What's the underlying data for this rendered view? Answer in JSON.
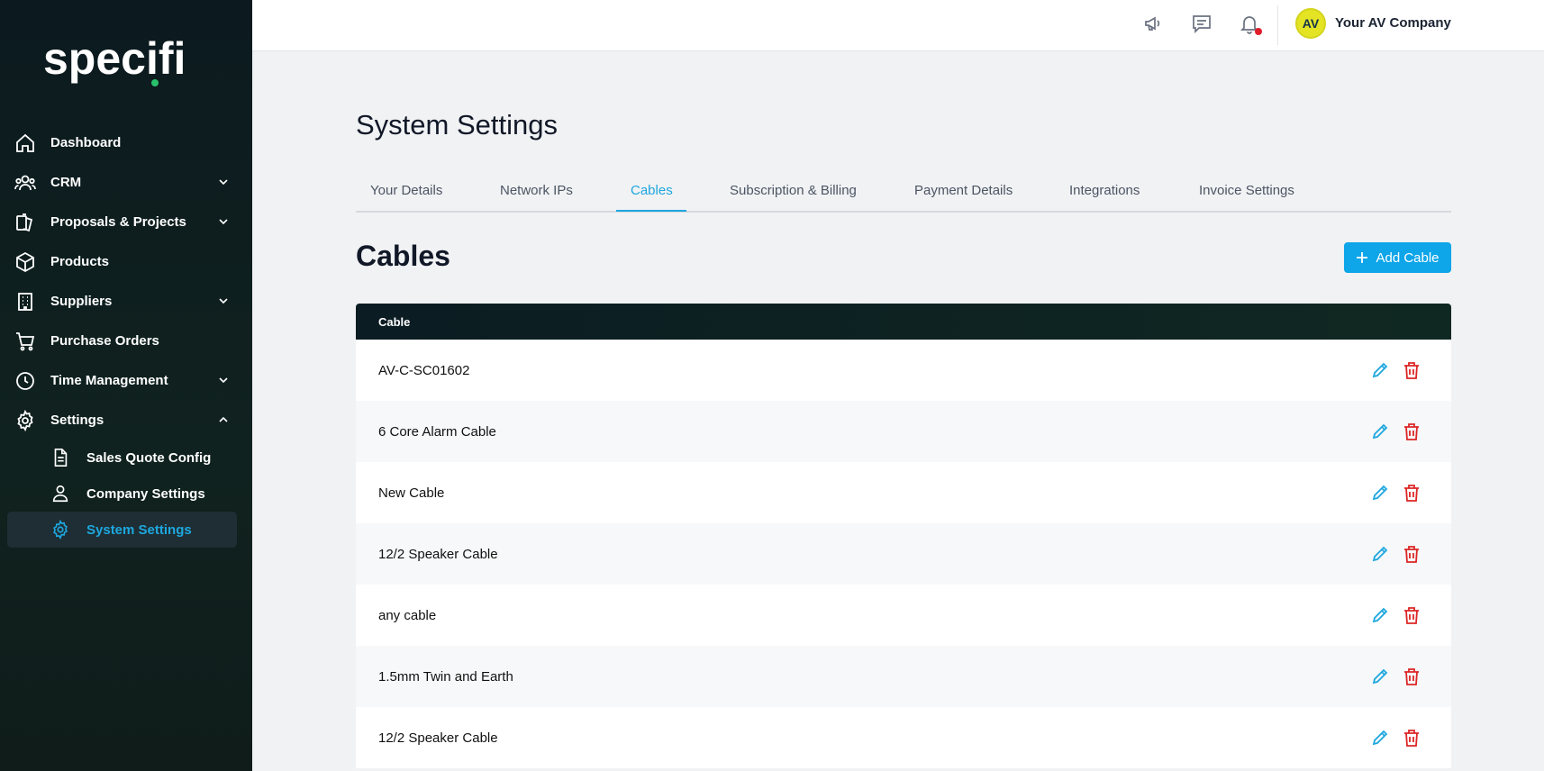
{
  "brand": {
    "logo_text": "specifi",
    "accent": "#1ea7de",
    "logo_dot": "#27c26b"
  },
  "sidebar": {
    "items": [
      {
        "label": "Dashboard",
        "icon": "home-icon"
      },
      {
        "label": "CRM",
        "icon": "users-icon",
        "expandable": true
      },
      {
        "label": "Proposals & Projects",
        "icon": "documents-icon",
        "expandable": true
      },
      {
        "label": "Products",
        "icon": "box-icon"
      },
      {
        "label": "Suppliers",
        "icon": "building-icon",
        "expandable": true
      },
      {
        "label": "Purchase Orders",
        "icon": "cart-icon"
      },
      {
        "label": "Time Management",
        "icon": "clock-icon",
        "expandable": true
      },
      {
        "label": "Settings",
        "icon": "gear-icon",
        "expanded": true
      }
    ],
    "sub_items": [
      {
        "label": "Sales Quote Config",
        "icon": "file-icon"
      },
      {
        "label": "Company Settings",
        "icon": "people-icon"
      },
      {
        "label": "System Settings",
        "icon": "gear-icon",
        "active": true
      }
    ]
  },
  "topbar": {
    "icons": [
      "megaphone-icon",
      "chat-icon",
      "bell-icon"
    ],
    "avatar_initials": "AV",
    "company_name": "Your AV Company"
  },
  "page": {
    "title": "System Settings"
  },
  "tabs": [
    {
      "label": "Your Details"
    },
    {
      "label": "Network IPs"
    },
    {
      "label": "Cables",
      "active": true
    },
    {
      "label": "Subscription & Billing"
    },
    {
      "label": "Payment Details"
    },
    {
      "label": "Integrations"
    },
    {
      "label": "Invoice Settings"
    }
  ],
  "section": {
    "title": "Cables",
    "add_button_label": "Add Cable"
  },
  "table": {
    "header": "Cable",
    "rows": [
      {
        "name": "AV-C-SC01602"
      },
      {
        "name": "6 Core Alarm Cable"
      },
      {
        "name": "New Cable"
      },
      {
        "name": "12/2 Speaker Cable"
      },
      {
        "name": "any cable"
      },
      {
        "name": "1.5mm Twin and Earth"
      },
      {
        "name": "12/2 Speaker Cable"
      }
    ]
  }
}
